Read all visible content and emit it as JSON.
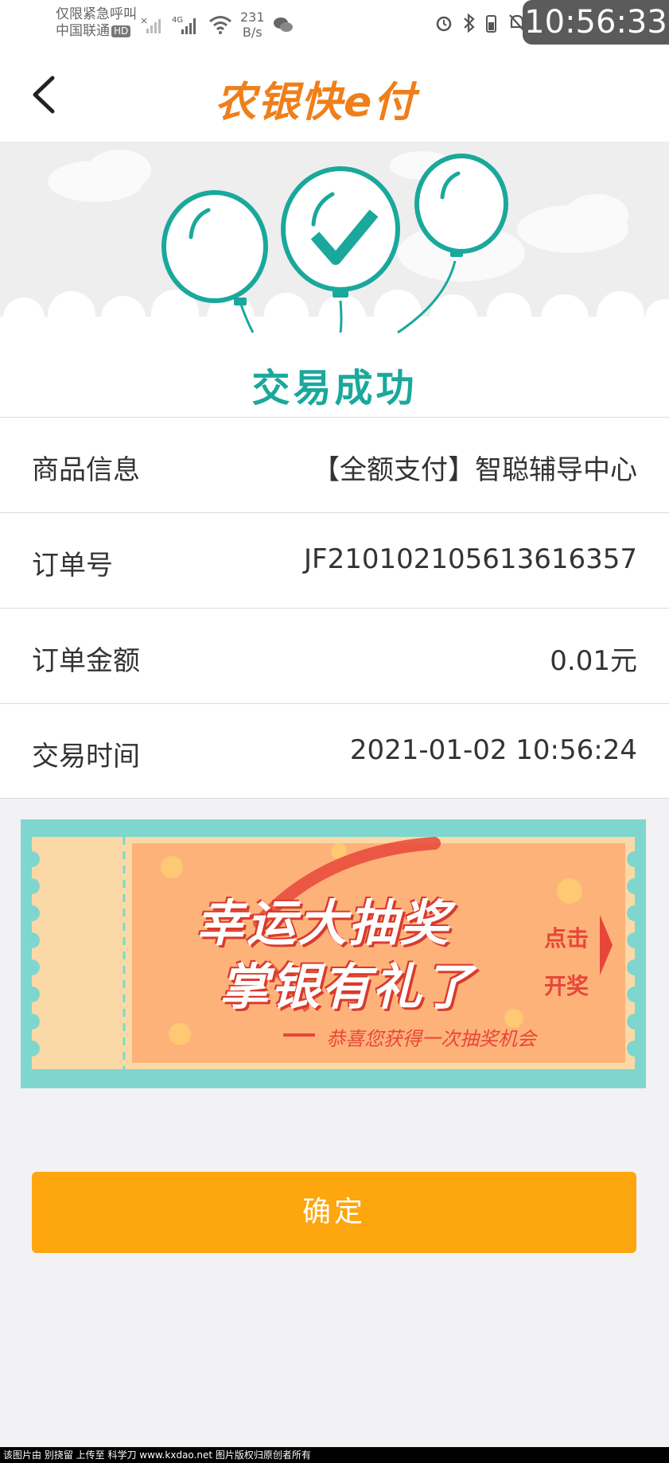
{
  "status_bar": {
    "carrier_line1": "仅限紧急呼叫",
    "carrier_line2": "中国联通",
    "hd_badge": "HD",
    "network": "4G",
    "speed_value": "231",
    "speed_unit": "B/s",
    "battery": "25",
    "time": "10:56:33"
  },
  "header": {
    "logo_text": "农银快e付"
  },
  "result": {
    "title": "交易成功"
  },
  "details": [
    {
      "label": "商品信息",
      "value": "【全额支付】智聪辅导中心"
    },
    {
      "label": "订单号",
      "value": "JF21010210561361635​7"
    },
    {
      "label": "订单金额",
      "value": "0.01元"
    },
    {
      "label": "交易时间",
      "value": "2021-01-02 10:56:24"
    }
  ],
  "banner": {
    "line1": "幸运大抽奖",
    "line2": "掌银有礼了",
    "subtitle": "恭喜您获得一次抽奖机会",
    "cta_line1": "点击",
    "cta_line2": "开奖"
  },
  "confirm_button": "确定",
  "footer_text": "该图片由 别挠留 上传至 科学刀 www.kxdao.net 图片版权归原创者所有",
  "colors": {
    "brand_orange": "#ef7f1a",
    "success_teal": "#1aa89c",
    "button_orange": "#fda60d",
    "banner_teal": "#7fd6cf"
  }
}
